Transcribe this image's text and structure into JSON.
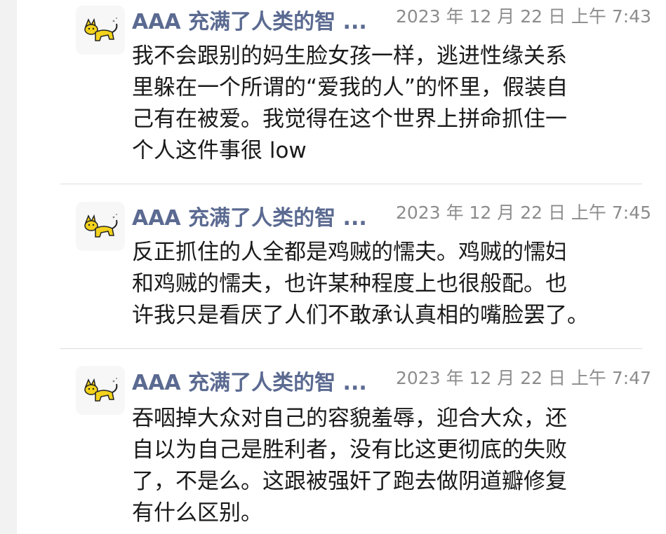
{
  "messages": [
    {
      "author": "AAA 充满了人类的智 ...",
      "time": "2023 年 12 月 22 日 上午 7:43",
      "text": "我不会跟别的妈生脸女孩一样，逃进性缘关系\n里躲在一个所谓的“爱我的人”的怀里，假装自\n己有在被爱。我觉得在这个世界上拼命抓住一\n个人这件事很 low"
    },
    {
      "author": "AAA 充满了人类的智 ...",
      "time": "2023 年 12 月 22 日 上午 7:45",
      "text": "反正抓住的人全都是鸡贼的懦夫。鸡贼的懦妇\n和鸡贼的懦夫，也许某种程度上也很般配。也\n许我只是看厌了人们不敢承认真相的嘴脸罢了。"
    },
    {
      "author": "AAA 充满了人类的智 ...",
      "time": "2023 年 12 月 22 日 上午 7:47",
      "text": "吞咽掉大众对自己的容貌羞辱，迎合大众，还\n自以为自己是胜利者，没有比这更彻底的失败\n了，不是么。这跟被强奸了跑去做阴道瓣修复\n有什么区别。"
    }
  ],
  "colors": {
    "author": "#5b6a91",
    "time": "#8c8c8c",
    "text": "#1a1a1a",
    "avatar_cat": "#f3d21c"
  },
  "icons": {
    "avatar": "yellow-cat-icon"
  }
}
